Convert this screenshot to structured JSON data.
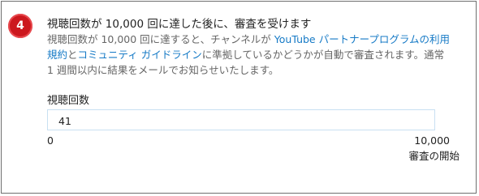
{
  "step": {
    "number": "4",
    "title": "視聴回数が 10,000 回に達した後に、審査を受けます"
  },
  "description": {
    "part1": "視聴回数が 10,000 回に達すると、チャンネルが ",
    "link1": "YouTube パートナープログラムの利用規約",
    "part2": "と",
    "link2": "コミュニティ ガイドライン",
    "part3": "に準拠しているかどうかが自動で審査されます。通常 1 週間以内に結果をメールでお知らせいたします。"
  },
  "views": {
    "label": "視聴回数",
    "value": "41"
  },
  "range": {
    "min": "0",
    "max": "10,000",
    "max_caption": "審査の開始"
  },
  "colors": {
    "badge": "#cc181e",
    "link": "#167ac6",
    "border": "#6f6f6f",
    "field_border": "#c8e0f2"
  }
}
